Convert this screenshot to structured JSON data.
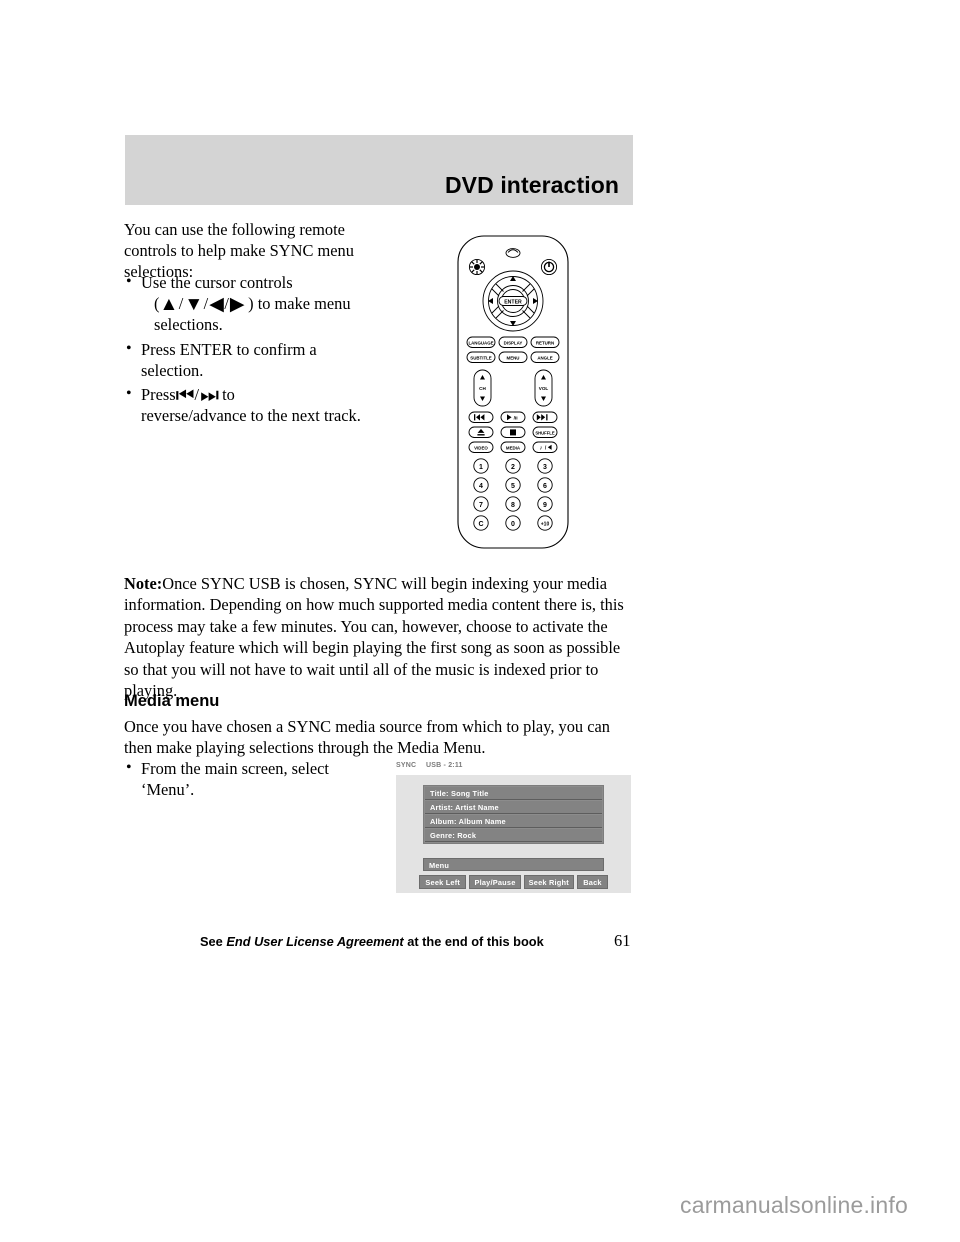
{
  "header": {
    "title": "DVD interaction"
  },
  "intro": {
    "paragraph": "You can use the following remote controls to help make SYNC menu selections:"
  },
  "bullets": [
    {
      "id": "cursor-controls",
      "line1": "Use the cursor controls",
      "prefix": "(",
      "glyph_up": "▲",
      "glyph_down": "▼",
      "glyph_left": "◀",
      "glyph_right": "▶",
      "slash": "/",
      "suffix": ") to make menu",
      "line3": "selections."
    },
    {
      "id": "enter-confirm",
      "line1": "Press ENTER to confirm a",
      "line2": "selection."
    },
    {
      "id": "seek-track",
      "line1": "Press",
      "glyph_rev": "⏮",
      "glyph_fwd": "⏭",
      "slash": "/",
      "after": "to",
      "line2": "reverse/advance to the next track."
    }
  ],
  "note": {
    "label": "Note:",
    "body": "Once SYNC USB is chosen, SYNC will begin indexing your media information. Depending on how much supported media content there is, this process may take a few minutes. You can, however, choose to activate the Autoplay feature which will begin playing the first song as soon as possible so that you will not have to wait until all of the music is indexed prior to playing."
  },
  "media_section": {
    "heading": "Media menu",
    "paragraph": "Once you have chosen a SYNC media source from which to play, you can then make playing selections through the Media Menu.",
    "bullet_line1": "From the main screen, select",
    "bullet_line2": "‘Menu’."
  },
  "sync_screen": {
    "source_label": "SYNC",
    "status_label": "USB - 2:11",
    "info_rows": [
      "Title:  Song Title",
      "Artist:  Artist Name",
      "Album:  Album Name",
      "Genre:  Rock"
    ],
    "menu_label": "Menu",
    "buttons": [
      "Seek Left",
      "Play/Pause",
      "Seek Right",
      "Back"
    ],
    "colors": {
      "panel_bg": "#e3e3e3",
      "row_bg": "#838383",
      "text": "#ffffff"
    }
  },
  "remote": {
    "top_icons": [
      "brightness-icon",
      "lens-icon",
      "power-icon"
    ],
    "dpad": {
      "center_label": "ENTER",
      "up": "▲",
      "down": "▼",
      "left": "◀",
      "right": "▶"
    },
    "row_buttons": [
      [
        "LANGUAGE",
        "DISPLAY",
        "RETURN"
      ],
      [
        "SUBTITLE",
        "MENU",
        "ANGLE"
      ]
    ],
    "rockers": [
      {
        "label": "CH",
        "up": "▲",
        "down": "▼"
      },
      {
        "label": "VOL",
        "up": "▲",
        "down": "▼"
      }
    ],
    "transport": [
      [
        "⏮",
        "▶/II",
        "⏭"
      ],
      [
        "⏏",
        "■",
        "SHUFFLE"
      ],
      [
        "VIDEO",
        "MEDIA",
        "♪/◀"
      ]
    ],
    "keypad": [
      "1",
      "2",
      "3",
      "4",
      "5",
      "6",
      "7",
      "8",
      "9",
      "C",
      "0",
      "+10"
    ]
  },
  "footer": {
    "see": "See",
    "doc_title": "End User License Agreement",
    "tail": "at the end of this book",
    "page_number": "61"
  },
  "watermark": {
    "text": "carmanualsonline.info"
  }
}
